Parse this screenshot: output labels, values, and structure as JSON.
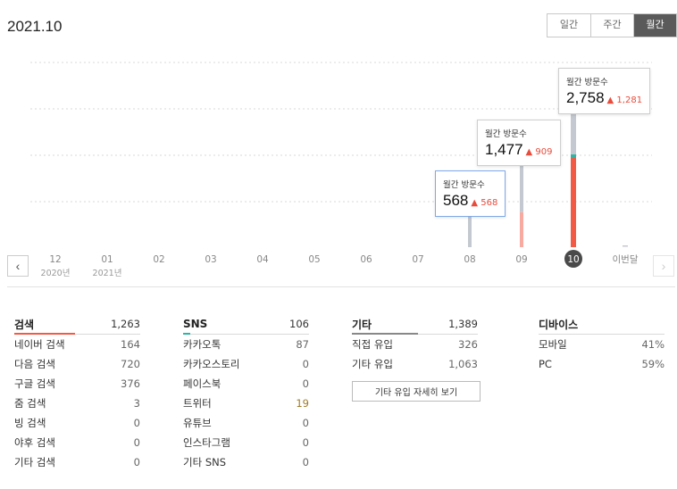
{
  "header": {
    "title": "2021.10"
  },
  "period_tabs": [
    {
      "label": "일간",
      "active": false
    },
    {
      "label": "주간",
      "active": false
    },
    {
      "label": "월간",
      "active": true
    }
  ],
  "chart_data": {
    "type": "bar",
    "categories": [
      "12",
      "01",
      "02",
      "03",
      "04",
      "05",
      "06",
      "07",
      "08",
      "09",
      "10",
      "이번달"
    ],
    "year_labels": [
      "2020년",
      "2021년",
      "",
      "",
      "",
      "",
      "",
      "",
      "",
      "",
      "",
      ""
    ],
    "values": [
      null,
      null,
      null,
      null,
      null,
      null,
      null,
      null,
      568,
      1477,
      2758,
      null
    ],
    "highlight_category": "10",
    "grid": true,
    "ylim": [
      0,
      3000
    ],
    "colors": {
      "bar_base": "#c4c8d0",
      "increase": "#f25a45",
      "increase_light": "#f8aaa0",
      "marker": "#2bb5a5",
      "highlight_border": "#7fa9e8"
    }
  },
  "tooltips": [
    {
      "label": "월간 방문수",
      "value": "568",
      "delta": "568",
      "category": "08"
    },
    {
      "label": "월간 방문수",
      "value": "1,477",
      "delta": "909",
      "category": "09"
    },
    {
      "label": "월간 방문수",
      "value": "2,758",
      "delta": "1,281",
      "category": "10"
    }
  ],
  "nav": {
    "prev": "‹",
    "next": "›"
  },
  "stats": {
    "search": {
      "title": "검색",
      "total": "1,263",
      "accent": "#f25a45",
      "items": [
        {
          "name": "네이버 검색",
          "value": "164"
        },
        {
          "name": "다음 검색",
          "value": "720"
        },
        {
          "name": "구글 검색",
          "value": "376"
        },
        {
          "name": "줌 검색",
          "value": "3"
        },
        {
          "name": "빙 검색",
          "value": "0"
        },
        {
          "name": "야후 검색",
          "value": "0"
        },
        {
          "name": "기타 검색",
          "value": "0"
        }
      ]
    },
    "sns": {
      "title": "SNS",
      "total": "106",
      "accent": "#2bb5a5",
      "items": [
        {
          "name": "카카오톡",
          "value": "87"
        },
        {
          "name": "카카오스토리",
          "value": "0"
        },
        {
          "name": "페이스북",
          "value": "0"
        },
        {
          "name": "트위터",
          "value": "19"
        },
        {
          "name": "유튜브",
          "value": "0"
        },
        {
          "name": "인스타그램",
          "value": "0"
        },
        {
          "name": "기타 SNS",
          "value": "0"
        }
      ]
    },
    "other": {
      "title": "기타",
      "total": "1,389",
      "accent": "#888888",
      "items": [
        {
          "name": "직접 유입",
          "value": "326"
        },
        {
          "name": "기타 유입",
          "value": "1,063"
        }
      ],
      "detail_button": "기타 유입 자세히 보기"
    },
    "device": {
      "title": "디바이스",
      "items": [
        {
          "name": "모바일",
          "value": "41%"
        },
        {
          "name": "PC",
          "value": "59%"
        }
      ]
    }
  }
}
